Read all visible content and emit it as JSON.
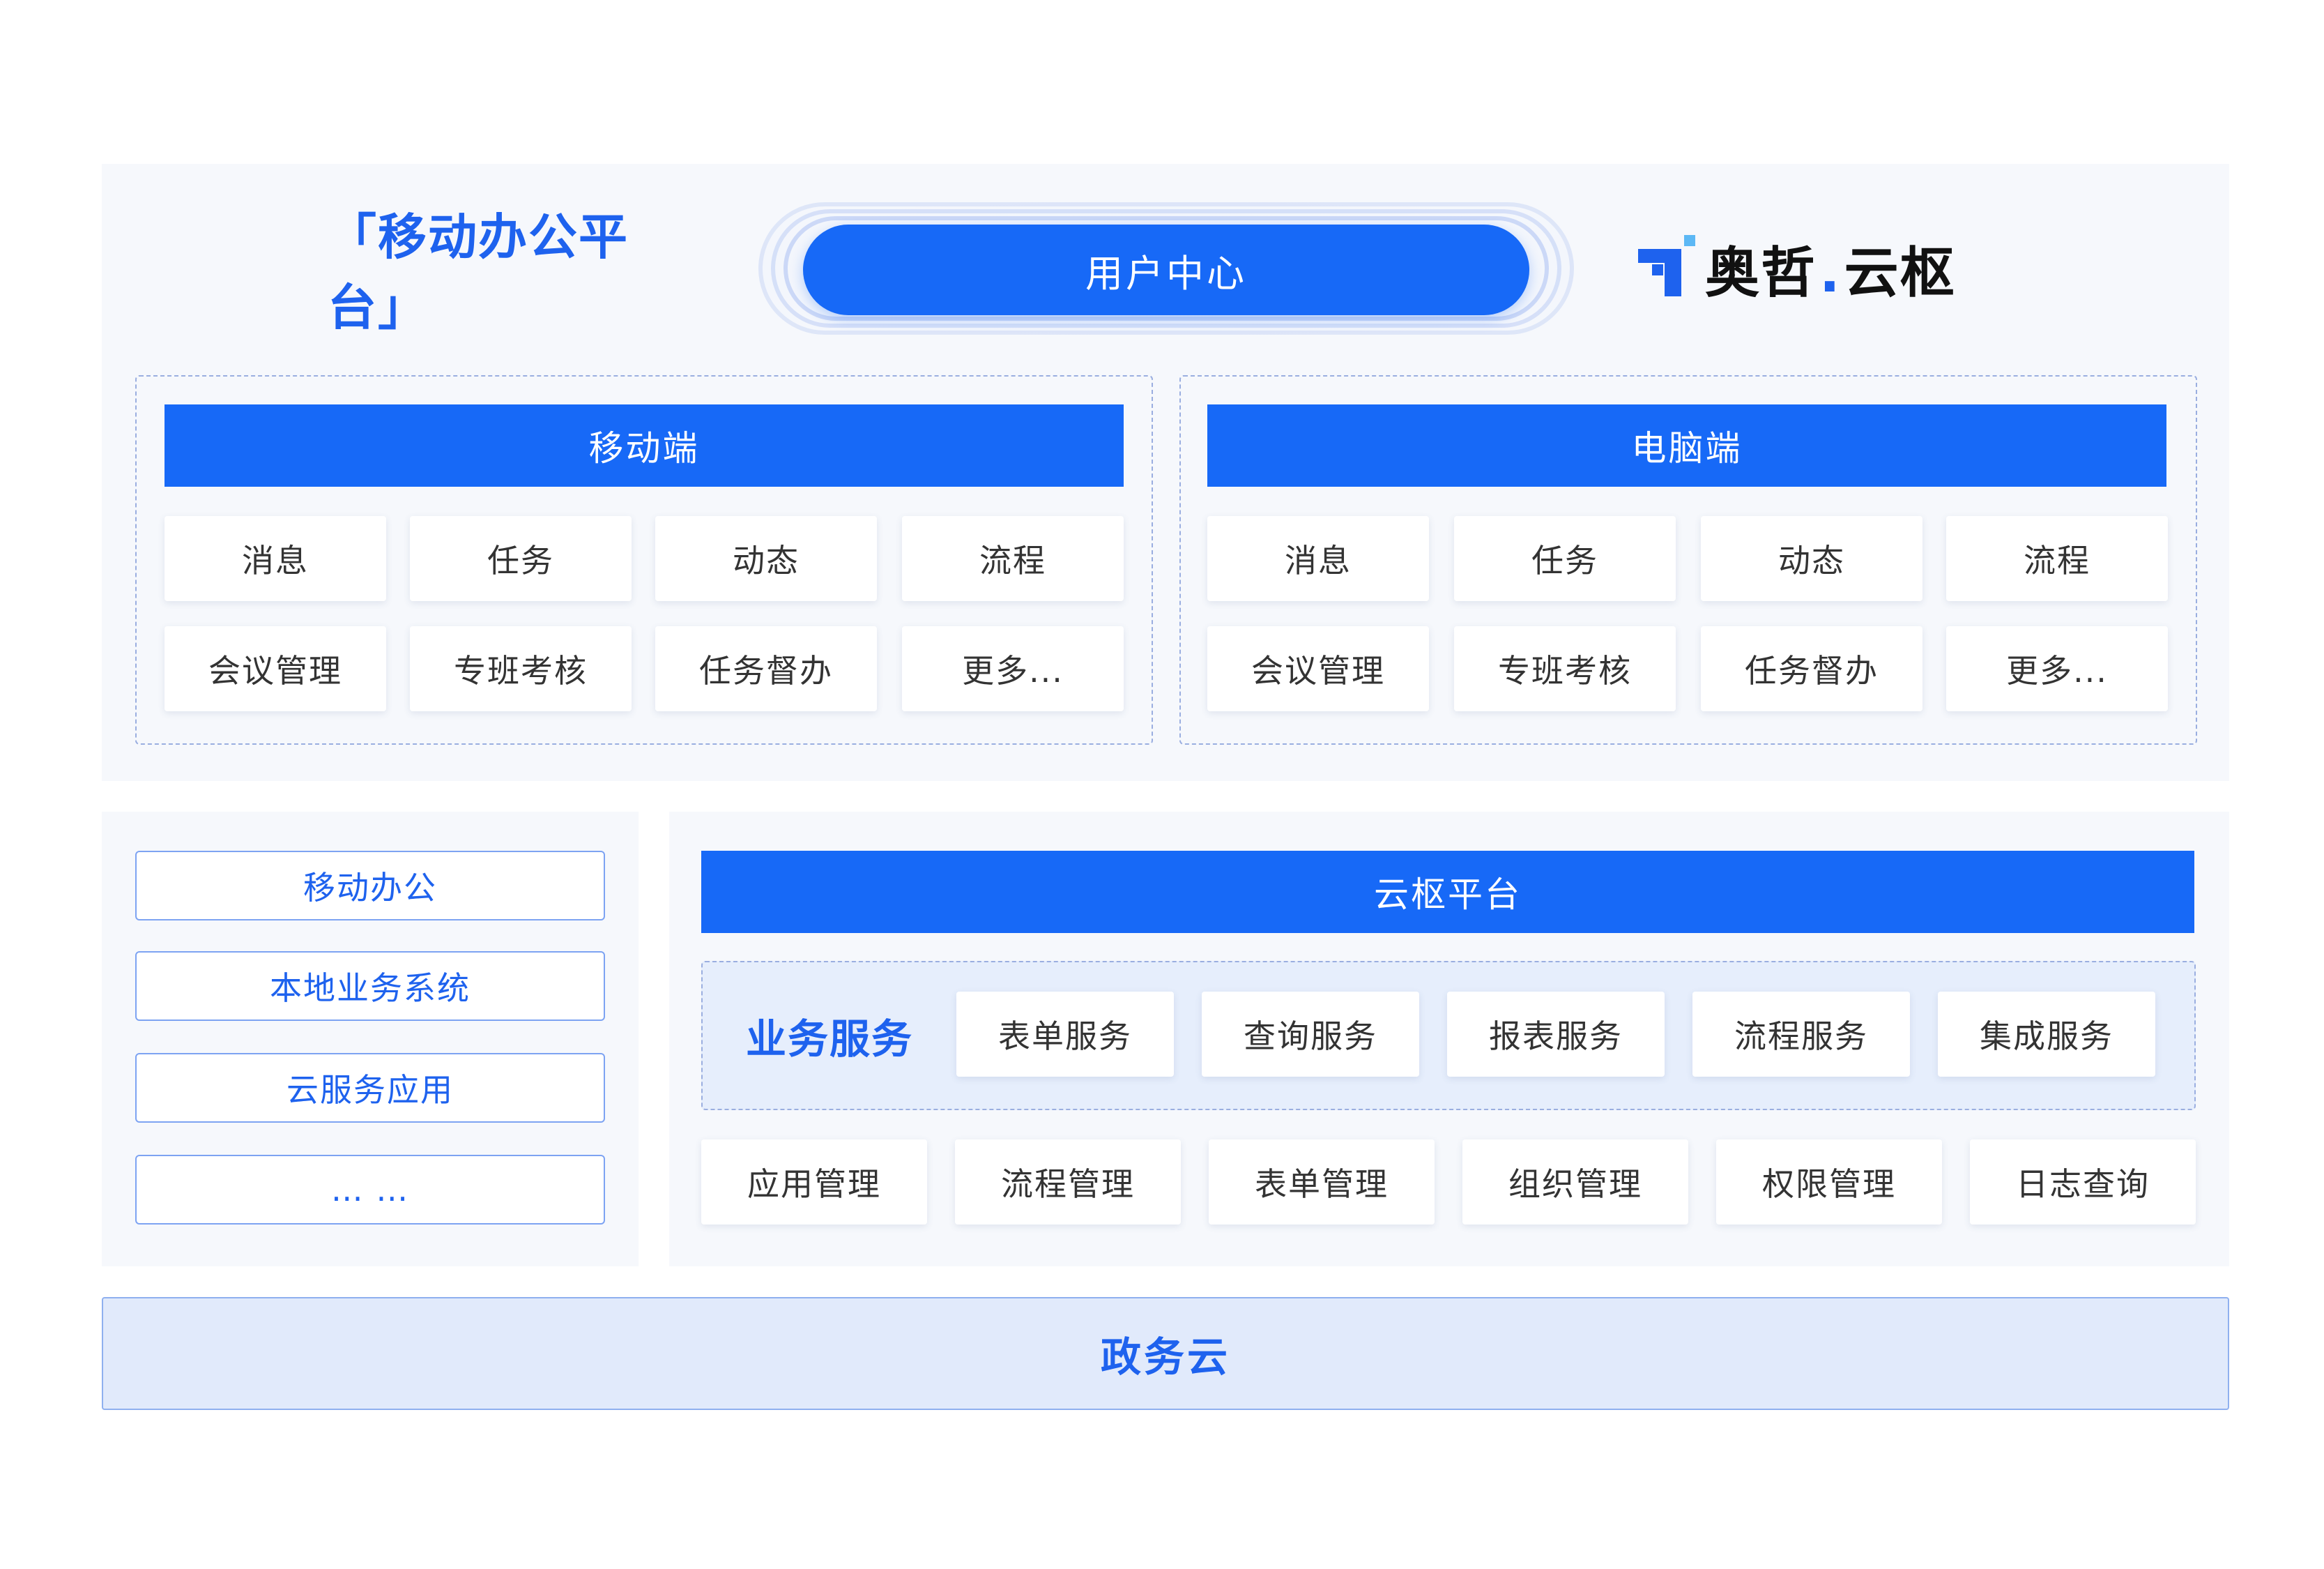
{
  "top": {
    "title": "「移动办公平台」",
    "user_center": "用户中心",
    "logo": {
      "name": "奥哲",
      "separator": ".",
      "product": "云枢",
      "colors": {
        "primary": "#1e62ee",
        "accent": "#5cb8f5",
        "text": "#111111"
      }
    }
  },
  "mobile": {
    "header": "移动端",
    "row1": [
      "消息",
      "任务",
      "动态",
      "流程"
    ],
    "row2": [
      "会议管理",
      "专班考核",
      "任务督办",
      "更多..."
    ]
  },
  "pc": {
    "header": "电脑端",
    "row1": [
      "消息",
      "任务",
      "动态",
      "流程"
    ],
    "row2": [
      "会议管理",
      "专班考核",
      "任务督办",
      "更多..."
    ]
  },
  "left_list": [
    "移动办公",
    "本地业务系统",
    "云服务应用",
    "… …"
  ],
  "platform": {
    "header": "云枢平台",
    "business_label": "业务服务",
    "business_services": [
      "表单服务",
      "查询服务",
      "报表服务",
      "流程服务",
      "集成服务"
    ],
    "management": [
      "应用管理",
      "流程管理",
      "表单管理",
      "组织管理",
      "权限管理",
      "日志查询"
    ]
  },
  "footer": {
    "label": "政务云"
  },
  "colors": {
    "primary_blue": "#1769f7",
    "text_blue": "#1e62ee",
    "panel_bg": "#f6f8fc",
    "light_blue": "#e1eafb"
  }
}
